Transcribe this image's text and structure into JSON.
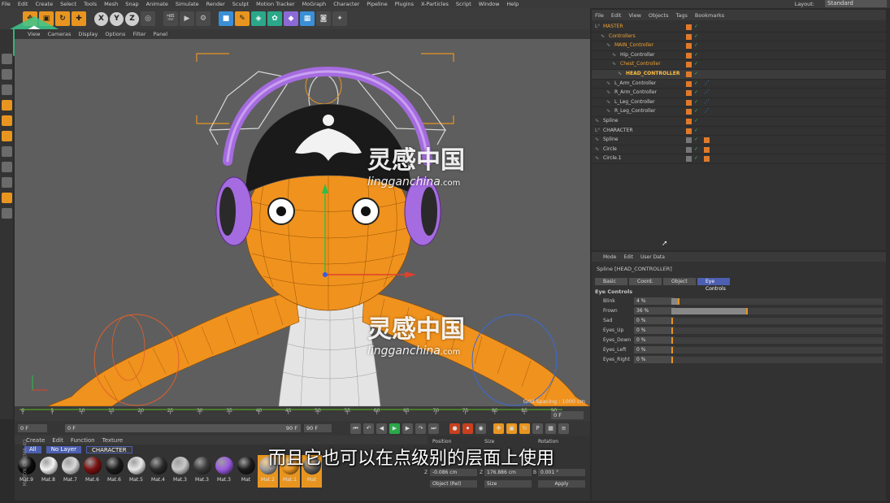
{
  "menubar": {
    "items": [
      "File",
      "Edit",
      "Create",
      "Select",
      "Tools",
      "Mesh",
      "Snap",
      "Animate",
      "Simulate",
      "Render",
      "Sculpt",
      "Motion Tracker",
      "MoGraph",
      "Character",
      "Pipeline",
      "Plugins",
      "X-Particles",
      "Script",
      "Window",
      "Help"
    ],
    "layout_label": "Layout:",
    "layout_value": "Standard"
  },
  "toolbar": {
    "axis_x": "X",
    "axis_y": "Y",
    "axis_z": "Z"
  },
  "viewport": {
    "menu": [
      "View",
      "Cameras",
      "Display",
      "Options",
      "Filter",
      "Panel"
    ],
    "grid_label": "Grid Spacing : 1000 cm"
  },
  "timeline": {
    "ticks": [
      "0",
      "5",
      "10",
      "15",
      "20",
      "25",
      "30",
      "35",
      "40",
      "45",
      "50",
      "55",
      "60",
      "65",
      "70",
      "75",
      "80",
      "85",
      "90"
    ],
    "end_field": "0 F",
    "start_field": "0 F",
    "current_field": "0 F",
    "max_field": "90 F",
    "max_field2": "90 F"
  },
  "materials": {
    "menu": [
      "Create",
      "Edit",
      "Function",
      "Texture"
    ],
    "filters": [
      "All",
      "No Layer",
      "CHARACTER"
    ],
    "items": [
      {
        "label": "Mat.9",
        "color": "#0a0a0a"
      },
      {
        "label": "Mat.8",
        "color": "#f2f2f2"
      },
      {
        "label": "Mat.7",
        "color": "#d8d8d8"
      },
      {
        "label": "Mat.6",
        "color": "#7a1010"
      },
      {
        "label": "Mat.6",
        "color": "#1a1a1a"
      },
      {
        "label": "Mat.5",
        "color": "#e8e8e8"
      },
      {
        "label": "Mat.4",
        "color": "#2a2a2a"
      },
      {
        "label": "Mat.3",
        "color": "#c8c8c8"
      },
      {
        "label": "Mat.3",
        "color": "#3a3a3a"
      },
      {
        "label": "Mat.3",
        "color": "#9a5ae0"
      },
      {
        "label": "Mat",
        "color": "#1a1a1a"
      },
      {
        "label": "Mat.2",
        "color": "#9a9a9a"
      },
      {
        "label": "Mat.1",
        "color": "#e89520"
      },
      {
        "label": "Mat",
        "color": "#5a5a5a"
      }
    ],
    "side_label": "MAXON CINEMA 4D"
  },
  "coords": {
    "headers": [
      "Position",
      "Size",
      "Rotation"
    ],
    "row_z": {
      "axis": "Z",
      "pos": "-0.086 cm",
      "size_axis": "Z",
      "size": "176.886 cm",
      "rot_axis": "B",
      "rot": "0.001 °"
    },
    "mode": "Object (Rel)",
    "size_mode": "Size",
    "apply": "Apply"
  },
  "objects": {
    "menu": [
      "File",
      "Edit",
      "View",
      "Objects",
      "Tags",
      "Bookmarks"
    ],
    "rows": [
      {
        "name": "MASTER",
        "indent": 0,
        "state": "sel"
      },
      {
        "name": "Controllers",
        "indent": 1,
        "state": "sel"
      },
      {
        "name": "MAIN_Controller",
        "indent": 2,
        "state": "sel"
      },
      {
        "name": "Hip_Controller",
        "indent": 3,
        "state": ""
      },
      {
        "name": "Chest_Controller",
        "indent": 3,
        "state": "sel"
      },
      {
        "name": "HEAD_CONTROLLER",
        "indent": 4,
        "state": "hl"
      },
      {
        "name": "L_Arm_Controller",
        "indent": 2,
        "state": ""
      },
      {
        "name": "R_Arm_Controller",
        "indent": 2,
        "state": ""
      },
      {
        "name": "L_Leg_Controller",
        "indent": 2,
        "state": ""
      },
      {
        "name": "R_Leg_Controller",
        "indent": 2,
        "state": ""
      },
      {
        "name": "Spline",
        "indent": 0,
        "state": ""
      },
      {
        "name": "CHARACTER",
        "indent": 0,
        "state": ""
      },
      {
        "name": "Spline",
        "indent": 0,
        "state": ""
      },
      {
        "name": "Circle",
        "indent": 0,
        "state": ""
      },
      {
        "name": "Circle.1",
        "indent": 0,
        "state": ""
      }
    ]
  },
  "attributes": {
    "menu": [
      "Mode",
      "Edit",
      "User Data"
    ],
    "title": "Spline [HEAD_CONTROLLER]",
    "tabs": [
      "Basic",
      "Coord.",
      "Object",
      "Eye Controls"
    ],
    "active_tab": "Eye Controls",
    "section": "Eye Controls",
    "params": [
      {
        "name": "Blink",
        "value": "4 %",
        "fraction": 0.04
      },
      {
        "name": "Frown",
        "value": "36 %",
        "fraction": 0.36
      },
      {
        "name": "Sad",
        "value": "0 %",
        "fraction": 0
      },
      {
        "name": "Eyes_Up",
        "value": "0 %",
        "fraction": 0
      },
      {
        "name": "Eyes_Down",
        "value": "0 %",
        "fraction": 0
      },
      {
        "name": "Eyes_Left",
        "value": "0 %",
        "fraction": 0
      },
      {
        "name": "Eyes_Right",
        "value": "0 %",
        "fraction": 0
      }
    ]
  },
  "subtitle": "而且它也可以在点级别的层面上使用",
  "watermark": {
    "cn": "灵感中国",
    "en": "lingganchina",
    "suffix": ".com"
  },
  "colors": {
    "accent": "#e89520",
    "selection": "#4c5fb0",
    "character_orange": "#f0921e",
    "headphone_purple": "#a56be0"
  }
}
